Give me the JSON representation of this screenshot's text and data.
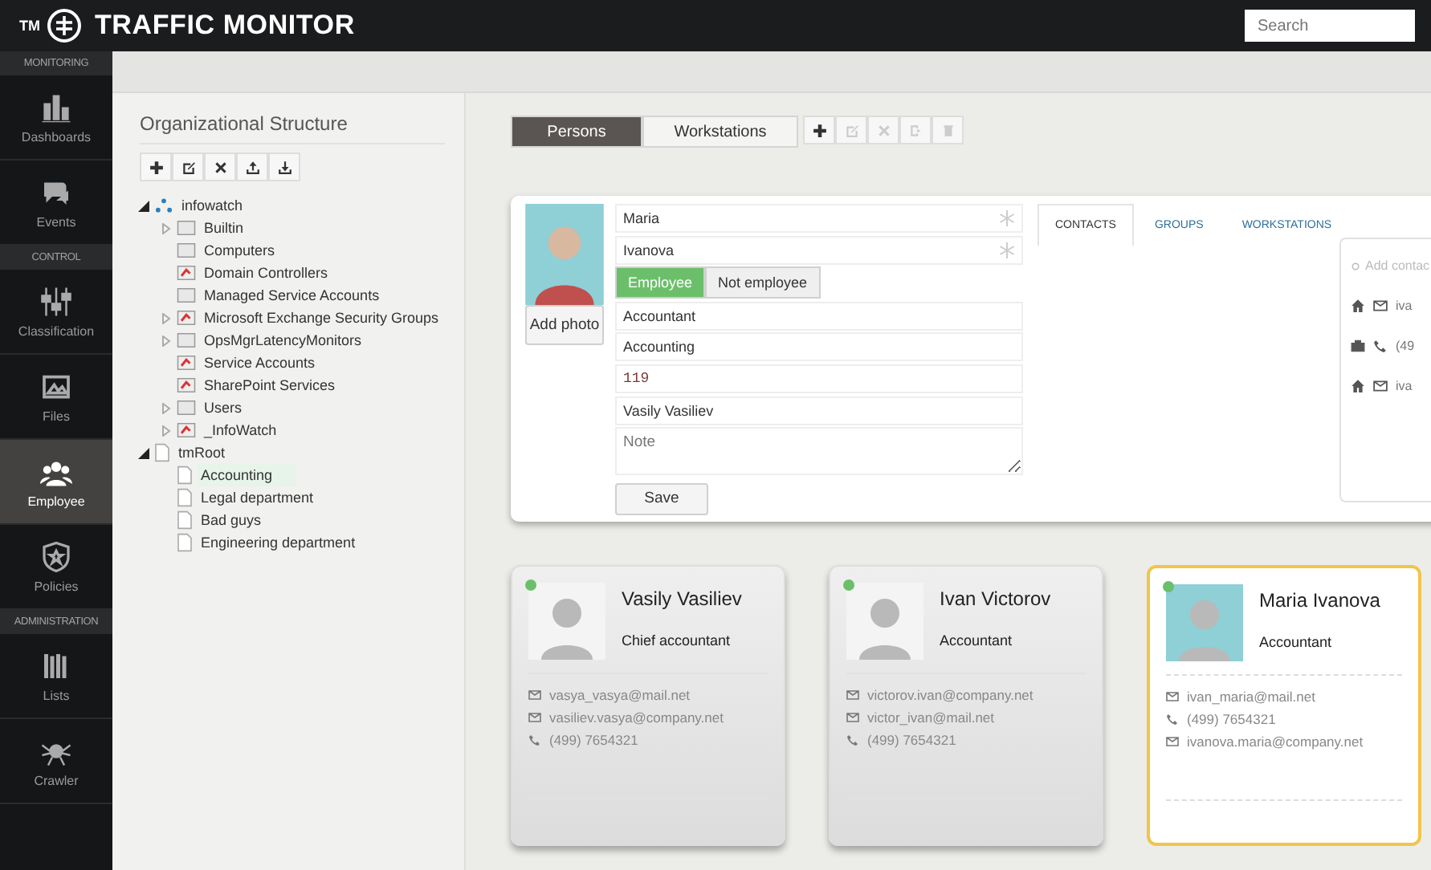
{
  "app": {
    "title": "TRAFFIC MONITOR",
    "logo_mark": "TM",
    "search": {
      "placeholder": "Search"
    }
  },
  "sidebar": {
    "sections": [
      {
        "title": "MONITORING",
        "items": [
          {
            "label": "Dashboards",
            "selected": false
          },
          {
            "label": "Events",
            "selected": false
          }
        ]
      },
      {
        "title": "CONTROL",
        "items": [
          {
            "label": "Classification",
            "selected": false
          },
          {
            "label": "Files",
            "selected": false
          },
          {
            "label": "Employee",
            "selected": true
          },
          {
            "label": "Policies",
            "selected": false
          }
        ]
      },
      {
        "title": "ADMINISTRATION",
        "items": [
          {
            "label": "Lists",
            "selected": false
          },
          {
            "label": "Crawler",
            "selected": false
          }
        ]
      }
    ]
  },
  "org": {
    "title": "Organizational Structure",
    "tree": [
      {
        "label": "infowatch",
        "kind": "domain",
        "expandable": true,
        "expanded": true,
        "selected": false,
        "children": [
          {
            "label": "Builtin",
            "kind": "folder",
            "expandable": true,
            "expanded": false,
            "selected": false
          },
          {
            "label": "Computers",
            "kind": "folder",
            "expandable": false,
            "selected": false
          },
          {
            "label": "Domain Controllers",
            "kind": "group",
            "expandable": false,
            "selected": false
          },
          {
            "label": "Managed Service Accounts",
            "kind": "folder",
            "expandable": false,
            "selected": false
          },
          {
            "label": "Microsoft Exchange Security Groups",
            "kind": "group",
            "expandable": true,
            "expanded": false,
            "selected": false
          },
          {
            "label": "OpsMgrLatencyMonitors",
            "kind": "folder",
            "expandable": true,
            "expanded": false,
            "selected": false
          },
          {
            "label": "Service Accounts",
            "kind": "group",
            "expandable": false,
            "selected": false
          },
          {
            "label": "SharePoint Services",
            "kind": "group",
            "expandable": false,
            "selected": false
          },
          {
            "label": "Users",
            "kind": "folder",
            "expandable": true,
            "expanded": false,
            "selected": false
          },
          {
            "label": "_InfoWatch",
            "kind": "group",
            "expandable": true,
            "expanded": false,
            "selected": false
          }
        ]
      },
      {
        "label": "tmRoot",
        "kind": "page",
        "expandable": true,
        "expanded": true,
        "selected": false,
        "children": [
          {
            "label": "Accounting",
            "kind": "page",
            "expandable": false,
            "selected": true
          },
          {
            "label": "Legal department",
            "kind": "page",
            "expandable": false,
            "selected": false
          },
          {
            "label": "Bad guys",
            "kind": "page",
            "expandable": false,
            "selected": false
          },
          {
            "label": "Engineering department",
            "kind": "page",
            "expandable": false,
            "selected": false
          }
        ]
      }
    ]
  },
  "view_tabs": [
    {
      "label": "Persons",
      "selected": true
    },
    {
      "label": "Workstations",
      "selected": false
    }
  ],
  "actions": [
    {
      "disabled": false
    },
    {
      "disabled": true
    },
    {
      "disabled": true
    },
    {
      "disabled": true
    },
    {
      "disabled": true
    }
  ],
  "form": {
    "add_photo": "Add photo",
    "fields": [
      {
        "kind": "text",
        "value": "Maria",
        "required": true
      },
      {
        "kind": "text",
        "value": "Ivanova",
        "required": true
      },
      {
        "kind": "toggle",
        "options": [
          {
            "label": "Employee",
            "selected": true
          },
          {
            "label": "Not employee",
            "selected": false
          }
        ]
      },
      {
        "kind": "text",
        "value": "Accountant",
        "required": false
      },
      {
        "kind": "text",
        "value": "Accounting",
        "required": false
      },
      {
        "kind": "mono",
        "value": "119",
        "required": false
      },
      {
        "kind": "text",
        "value": "Vasily Vasiliev",
        "required": false
      },
      {
        "kind": "note",
        "placeholder": "Note"
      }
    ],
    "save": "Save",
    "tabs": [
      {
        "label": "CONTACTS",
        "selected": true
      },
      {
        "label": "GROUPS",
        "selected": false
      },
      {
        "label": "WORKSTATIONS",
        "selected": false
      }
    ],
    "contacts": {
      "add": "Add contac",
      "rows": [
        {
          "kind": "home-email",
          "text": "iva"
        },
        {
          "kind": "work-phone",
          "text": "(49"
        },
        {
          "kind": "home-email",
          "text": "iva"
        }
      ]
    }
  },
  "cards": [
    {
      "name": "Vasily Vasiliev",
      "role": "Chief accountant",
      "color": "#6cbf6a",
      "selected": false,
      "contacts": [
        {
          "kind": "email",
          "text": "vasya_vasya@mail.net"
        },
        {
          "kind": "email",
          "text": "vasiliev.vasya@company.net"
        },
        {
          "kind": "phone",
          "text": "(499) 7654321"
        }
      ]
    },
    {
      "name": "Ivan Victorov",
      "role": "Accountant",
      "color": "#6cbf6a",
      "selected": false,
      "contacts": [
        {
          "kind": "email",
          "text": "victorov.ivan@company.net"
        },
        {
          "kind": "email",
          "text": "victor_ivan@mail.net"
        },
        {
          "kind": "phone",
          "text": "(499) 7654321"
        }
      ]
    },
    {
      "name": "Maria Ivanova",
      "role": "Accountant",
      "color": "#6cbf6a",
      "selected": true,
      "contacts": [
        {
          "kind": "email",
          "text": "ivan_maria@mail.net"
        },
        {
          "kind": "phone",
          "text": "(499) 7654321"
        },
        {
          "kind": "email",
          "text": "ivanova.maria@company.net"
        }
      ]
    }
  ]
}
